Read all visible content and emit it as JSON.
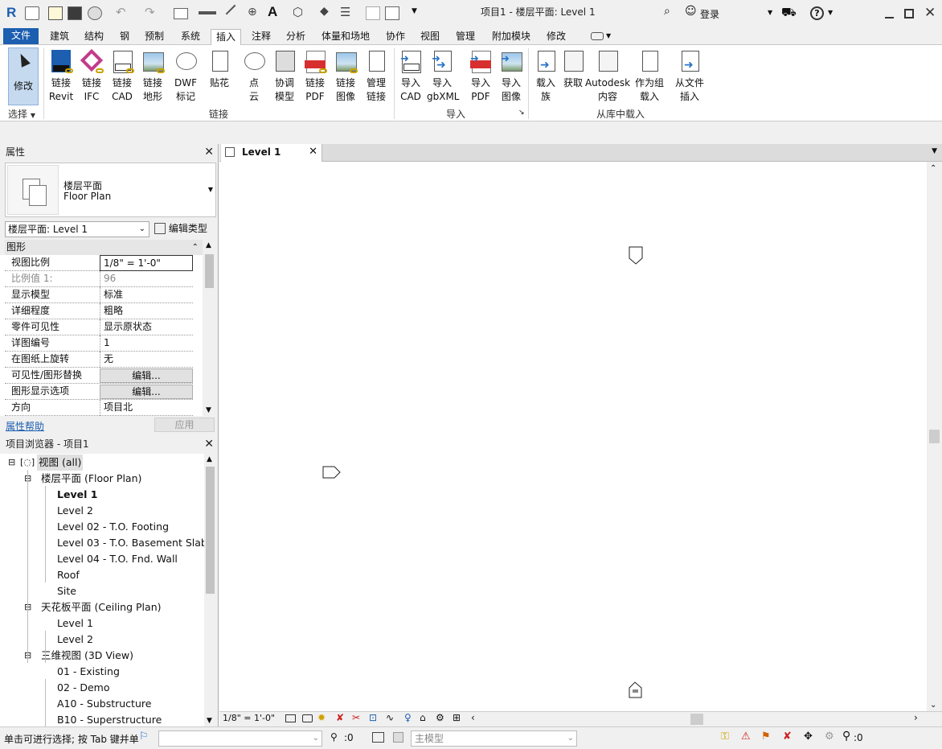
{
  "title_bar": {
    "title": "项目1 - 楼层平面: Level 1",
    "login_label": "登录",
    "help_label": "?"
  },
  "tabs": [
    "文件",
    "建筑",
    "结构",
    "钢",
    "预制",
    "系统",
    "插入",
    "注释",
    "分析",
    "体量和场地",
    "协作",
    "视图",
    "管理",
    "附加模块",
    "修改"
  ],
  "active_tab": "插入",
  "ribbon": {
    "select": {
      "modify_label": "修改",
      "select_label": "选择"
    },
    "link_panel": {
      "label": "链接",
      "buttons": [
        {
          "line1": "链接",
          "line2": "Revit",
          "icon": "revit-link-icon"
        },
        {
          "line1": "链接",
          "line2": "IFC",
          "icon": "ifc-link-icon"
        },
        {
          "line1": "链接",
          "line2": "CAD",
          "icon": "cad-link-icon"
        },
        {
          "line1": "链接",
          "line2": "地形",
          "icon": "topography-link-icon"
        },
        {
          "line1": "DWF",
          "line2": "标记",
          "icon": "dwf-markup-icon"
        },
        {
          "line1": "贴花",
          "line2": "",
          "icon": "decal-icon"
        },
        {
          "line1": "点",
          "line2": "云",
          "icon": "point-cloud-icon"
        },
        {
          "line1": "协调",
          "line2": "模型",
          "icon": "coordination-model-icon"
        },
        {
          "line1": "链接",
          "line2": "PDF",
          "icon": "pdf-link-icon"
        },
        {
          "line1": "链接",
          "line2": "图像",
          "icon": "image-link-icon"
        },
        {
          "line1": "管理",
          "line2": "链接",
          "icon": "manage-links-icon"
        }
      ]
    },
    "import_panel": {
      "label": "导入",
      "buttons": [
        {
          "line1": "导入",
          "line2": "CAD",
          "icon": "import-cad-icon"
        },
        {
          "line1": "导入",
          "line2": "gbXML",
          "icon": "import-gbxml-icon"
        },
        {
          "line1": "导入",
          "line2": "PDF",
          "icon": "import-pdf-icon"
        },
        {
          "line1": "导入",
          "line2": "图像",
          "icon": "import-image-icon"
        }
      ]
    },
    "library_panel": {
      "label": "从库中载入",
      "buttons": [
        {
          "line1": "载入",
          "line2": "族",
          "icon": "load-family-icon"
        },
        {
          "line1": "获取",
          "line2": "",
          "icon": "get-content-icon"
        },
        {
          "line1": "Autodesk",
          "line2": "内容",
          "icon": "autodesk-content-icon"
        },
        {
          "line1": "作为组",
          "line2": "载入",
          "icon": "load-as-group-icon"
        },
        {
          "line1": "从文件",
          "line2": "插入",
          "icon": "insert-from-file-icon"
        }
      ]
    }
  },
  "properties": {
    "panel_title": "属性",
    "type_line1": "楼层平面",
    "type_line2": "Floor Plan",
    "selector_value": "楼层平面: Level 1",
    "edit_type_label": "编辑类型",
    "section_label": "图形",
    "rows": [
      {
        "key": "视图比例",
        "value": "1/8\" = 1'-0\""
      },
      {
        "key": "比例值 1:",
        "value": "96"
      },
      {
        "key": "显示模型",
        "value": "标准"
      },
      {
        "key": "详细程度",
        "value": "粗略"
      },
      {
        "key": "零件可见性",
        "value": "显示原状态"
      },
      {
        "key": "详图编号",
        "value": "1"
      },
      {
        "key": "在图纸上旋转",
        "value": "无"
      },
      {
        "key": "可见性/图形替换",
        "value": "编辑..."
      },
      {
        "key": "图形显示选项",
        "value": "编辑..."
      },
      {
        "key": "方向",
        "value": "项目北"
      }
    ],
    "help_link": "属性帮助",
    "apply_label": "应用"
  },
  "project_browser": {
    "title": "项目浏览器 - 项目1",
    "items": [
      {
        "text": "视图 (all)",
        "level": 0
      },
      {
        "text": "楼层平面 (Floor Plan)",
        "level": 1
      },
      {
        "text": "Level 1",
        "level": 2,
        "bold": true
      },
      {
        "text": "Level 2",
        "level": 2
      },
      {
        "text": "Level 02 - T.O. Footing",
        "level": 2
      },
      {
        "text": "Level 03 - T.O. Basement Slab",
        "level": 2
      },
      {
        "text": "Level 04 - T.O. Fnd. Wall",
        "level": 2
      },
      {
        "text": "Roof",
        "level": 2
      },
      {
        "text": "Site",
        "level": 2
      },
      {
        "text": "天花板平面 (Ceiling Plan)",
        "level": 1
      },
      {
        "text": "Level 1",
        "level": 2
      },
      {
        "text": "Level 2",
        "level": 2
      },
      {
        "text": "三维视图 (3D View)",
        "level": 1
      },
      {
        "text": "01 - Existing",
        "level": 2
      },
      {
        "text": "02 - Demo",
        "level": 2
      },
      {
        "text": "A10 - Substructure",
        "level": 2
      },
      {
        "text": "B10 - Superstructure",
        "level": 2
      }
    ]
  },
  "view_tab": {
    "label": "Level 1"
  },
  "view_bar": {
    "scale": "1/8\" = 1'-0\""
  },
  "status_bar": {
    "message": "单击可进行选择; 按 Tab 键并单",
    "select_count": ":0",
    "model_placeholder": "主模型",
    "filter_count": ":0"
  },
  "colors": {
    "file_tab": "#1c5eb0",
    "ribbon_blue": "#2a73c6",
    "pdf_red": "#d72f2f"
  }
}
